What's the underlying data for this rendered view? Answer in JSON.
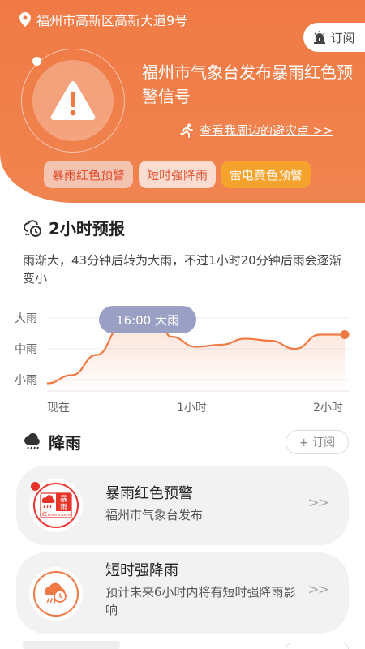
{
  "location": {
    "address": "福州市高新区高新大道9号"
  },
  "header": {
    "subscribe_label": "订阅",
    "alert_title": "福州市气象台发布暴雨红色预警信号",
    "nearby_link": "查看我周边的避灾点 >>",
    "tags": [
      {
        "label": "暴雨红色预警"
      },
      {
        "label": "短时强降雨"
      },
      {
        "label": "雷电黄色预警"
      }
    ]
  },
  "forecast": {
    "title": "2小时预报",
    "description": "雨渐大，43分钟后转为大雨，不过1小时20分钟后雨会逐渐变小",
    "bubble": "16:00 大雨"
  },
  "chart_data": {
    "type": "area",
    "y_categories": [
      "小雨",
      "中雨",
      "大雨"
    ],
    "x_tick_labels": [
      "现在",
      "1小时",
      "2小时"
    ],
    "x": [
      0,
      10,
      20,
      30,
      40,
      45,
      50,
      60,
      70,
      80,
      90,
      100,
      110,
      120
    ],
    "values": [
      0.15,
      0.35,
      0.85,
      1.55,
      1.75,
      1.7,
      1.3,
      1.05,
      1.1,
      1.25,
      1.2,
      1.0,
      1.35,
      1.35
    ],
    "ylim": [
      0,
      2.2
    ],
    "grid": true,
    "accent": "#f07a45"
  },
  "rain": {
    "title": "降雨",
    "subscribe_label": "+ 订阅",
    "cards": [
      {
        "title": "暴雨红色预警",
        "subtitle": "福州市气象台发布",
        "arrow": ">>",
        "icon_text_top": "暴",
        "icon_text_bottom": "雨",
        "icon_red": "红",
        "icon_en": "RAIN STORM"
      },
      {
        "title": "短时强降雨",
        "subtitle": "预计未来6小时内将有短时强降雨影响",
        "arrow": ">>"
      }
    ]
  },
  "colors": {
    "accent": "#f07a45",
    "warning_red": "#e8332a",
    "bubble": "#9a9fc4"
  }
}
